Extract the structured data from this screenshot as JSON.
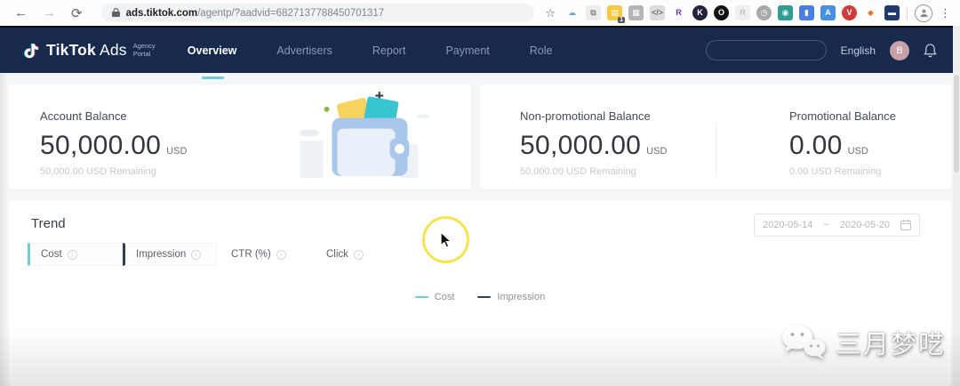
{
  "browser": {
    "back_glyph": "←",
    "forward_glyph": "→",
    "refresh_glyph": "⟳",
    "star_glyph": "☆",
    "menu_glyph": "⋮",
    "url_host": "ads.tiktok.com",
    "url_path": "/agentp/?aadvid=6827137788450701317",
    "extensions": [
      {
        "name": "cloud",
        "glyph": "☁",
        "bg": "transparent",
        "fg": "#6fa8dc"
      },
      {
        "name": "session-box",
        "glyph": "⧉",
        "bg": "#ececec",
        "fg": "#8a8a8a"
      },
      {
        "name": "notes-yellow",
        "glyph": "▤",
        "bg": "#f6c945",
        "fg": "#ffffff",
        "badge": "1"
      },
      {
        "name": "bank-grey",
        "glyph": "▦",
        "bg": "#b5b5b5",
        "fg": "#ffffff"
      },
      {
        "name": "code",
        "glyph": "</>",
        "bg": "#dcdcdc",
        "fg": "#6e6e6e"
      },
      {
        "name": "r-purple",
        "glyph": "R",
        "bg": "transparent",
        "fg": "#5e35b1"
      },
      {
        "name": "k-dark",
        "glyph": "K",
        "bg": "#23233c",
        "fg": "#ffffff",
        "round": true
      },
      {
        "name": "o-black",
        "glyph": "O",
        "bg": "#141414",
        "fg": "#ffffff",
        "round": true
      },
      {
        "name": "r-faded",
        "glyph": "R",
        "bg": "#f0f0f0",
        "fg": "#bdbdbd"
      },
      {
        "name": "timer-grey",
        "glyph": "◷",
        "bg": "#a9a9a9",
        "fg": "#ffffff",
        "round": true
      },
      {
        "name": "p-green",
        "glyph": "◉",
        "bg": "#2e9e93",
        "fg": "#ffffff"
      },
      {
        "name": "card-blue",
        "glyph": "▮",
        "bg": "#4a7fe0",
        "fg": "#ffffff"
      },
      {
        "name": "translate-blue",
        "glyph": "A",
        "bg": "#4a90e2",
        "fg": "#ffffff"
      },
      {
        "name": "v-red",
        "glyph": "V",
        "bg": "#d23b3b",
        "fg": "#ffffff",
        "round": true
      },
      {
        "name": "fox",
        "glyph": "◆",
        "bg": "transparent",
        "fg": "#e27625"
      },
      {
        "name": "navy-square",
        "glyph": "▬",
        "bg": "#1e3a6e",
        "fg": "#ffffff"
      }
    ]
  },
  "navbar": {
    "brand_main": "TikTok",
    "brand_ads": "Ads",
    "brand_sub1": "Agency",
    "brand_sub2": "Portal",
    "menu": [
      {
        "label": "Overview",
        "active": true
      },
      {
        "label": "Advertisers",
        "active": false
      },
      {
        "label": "Report",
        "active": false
      },
      {
        "label": "Payment",
        "active": false
      },
      {
        "label": "Role",
        "active": false
      }
    ],
    "search_placeholder": "",
    "language": "English",
    "avatar_initial": "B"
  },
  "balances": {
    "account": {
      "label": "Account Balance",
      "value": "50,000.00",
      "currency": "USD",
      "remaining": "50,000.00 USD Remaining"
    },
    "non_promotional": {
      "label": "Non-promotional Balance",
      "value": "50,000.00",
      "currency": "USD",
      "remaining": "50,000.00 USD Remaining"
    },
    "promotional": {
      "label": "Promotional Balance",
      "value": "0.00",
      "currency": "USD",
      "remaining": "0.00 USD Remaining"
    }
  },
  "trend": {
    "title": "Trend",
    "info_glyph": "i",
    "tabs": [
      {
        "label": "Cost",
        "accent": "#6fcdd3",
        "active": true
      },
      {
        "label": "Impression",
        "accent": "#2e3e54",
        "active": true
      },
      {
        "label": "CTR (%)",
        "accent": "",
        "active": false
      },
      {
        "label": "Click",
        "accent": "",
        "active": false
      }
    ],
    "date_start": "2020-05-14",
    "date_separator": "~",
    "date_end": "2020-05-20",
    "legend": [
      {
        "label": "Cost",
        "color": "#6fcdd3"
      },
      {
        "label": "Impression",
        "color": "#2e3e54"
      }
    ]
  },
  "watermark": {
    "text": "三月梦呓"
  },
  "colors": {
    "navbar_bg": "#17294d",
    "accent_teal": "#6fcdd3",
    "page_bg": "#f5f6f8"
  }
}
